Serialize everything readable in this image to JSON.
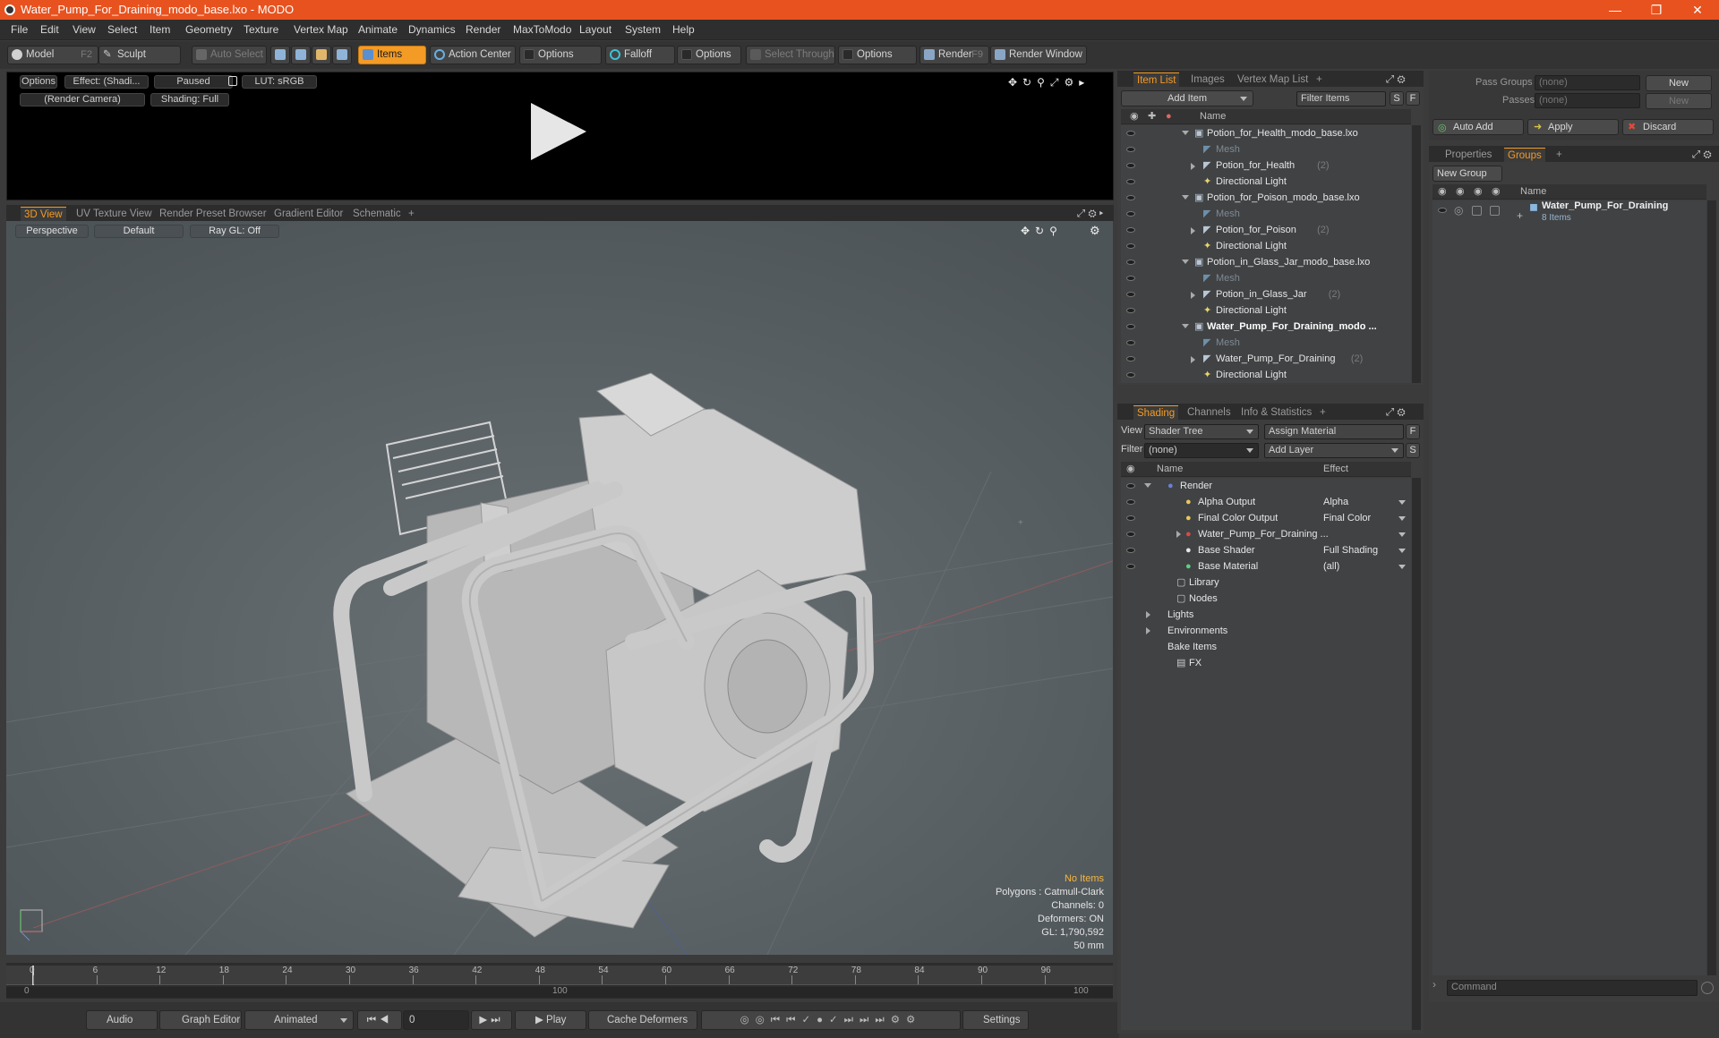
{
  "window": {
    "title": "Water_Pump_For_Draining_modo_base.lxo - MODO"
  },
  "menu": [
    "File",
    "Edit",
    "View",
    "Select",
    "Item",
    "Geometry",
    "Texture",
    "Vertex Map",
    "Animate",
    "Dynamics",
    "Render",
    "MaxToModo",
    "Layout",
    "System",
    "Help"
  ],
  "toolbar": {
    "model": "Model",
    "model_key": "F2",
    "sculpt": "Sculpt",
    "auto_select": "Auto Select",
    "items": "Items",
    "action_center": "Action Center",
    "options1": "Options",
    "falloff": "Falloff",
    "options2": "Options",
    "select_through": "Select Through",
    "options3": "Options",
    "render": "Render",
    "render_key": "F9",
    "render_window": "Render Window"
  },
  "preview": {
    "options": "Options",
    "effect": "Effect: (Shadi...",
    "paused": "Paused",
    "lut": "LUT: sRGB",
    "camera": "(Render Camera)",
    "shading": "Shading: Full"
  },
  "viewport_tabs": [
    "3D View",
    "UV Texture View",
    "Render Preset Browser",
    "Gradient Editor",
    "Schematic"
  ],
  "viewport": {
    "perspective": "Perspective",
    "default": "Default",
    "raygl": "Ray GL: Off",
    "stats": {
      "no_items": "No Items",
      "polygons": "Polygons : Catmull-Clark",
      "channels": "Channels: 0",
      "deformers": "Deformers: ON",
      "gl": "GL: 1,790,592",
      "focal": "50 mm"
    }
  },
  "timeline": {
    "ticks": [
      "0",
      "6",
      "12",
      "18",
      "24",
      "30",
      "36",
      "42",
      "48",
      "54",
      "60",
      "66",
      "72",
      "78",
      "84",
      "90",
      "96"
    ],
    "sub_ticks": [
      "0",
      "100",
      "100"
    ]
  },
  "bottom": {
    "audio": "Audio",
    "graph_editor": "Graph Editor",
    "animated": "Animated",
    "frame": "0",
    "play": "Play",
    "cache": "Cache Deformers",
    "settings": "Settings"
  },
  "item_list": {
    "tabs": [
      "Item List",
      "Images",
      "Vertex Map List"
    ],
    "add_item": "Add Item",
    "filter_items": "Filter Items",
    "s": "S",
    "f": "F",
    "col_name": "Name",
    "rows": [
      {
        "label": "Potion_for_Health_modo_base.lxo",
        "count": "",
        "type": "scene"
      },
      {
        "label": "Mesh",
        "count": "",
        "type": "mesh"
      },
      {
        "label": "Potion_for_Health",
        "count": "(2)",
        "type": "group"
      },
      {
        "label": "Directional Light",
        "count": "",
        "type": "light"
      },
      {
        "label": "Potion_for_Poison_modo_base.lxo",
        "count": "",
        "type": "scene"
      },
      {
        "label": "Mesh",
        "count": "",
        "type": "mesh"
      },
      {
        "label": "Potion_for_Poison",
        "count": "(2)",
        "type": "group"
      },
      {
        "label": "Directional Light",
        "count": "",
        "type": "light"
      },
      {
        "label": "Potion_in_Glass_Jar_modo_base.lxo",
        "count": "",
        "type": "scene"
      },
      {
        "label": "Mesh",
        "count": "",
        "type": "mesh"
      },
      {
        "label": "Potion_in_Glass_Jar",
        "count": "(2)",
        "type": "group"
      },
      {
        "label": "Directional Light",
        "count": "",
        "type": "light"
      },
      {
        "label": "Water_Pump_For_Draining_modo ...",
        "count": "",
        "type": "scene-bold"
      },
      {
        "label": "Mesh",
        "count": "",
        "type": "mesh"
      },
      {
        "label": "Water_Pump_For_Draining",
        "count": "(2)",
        "type": "group"
      },
      {
        "label": "Directional Light",
        "count": "",
        "type": "light"
      }
    ]
  },
  "shading": {
    "tabs": [
      "Shading",
      "Channels",
      "Info & Statistics"
    ],
    "view_label": "View",
    "view_value": "Shader Tree",
    "assign_material": "Assign Material",
    "filter_label": "Filter",
    "filter_value": "(none)",
    "add_layer": "Add Layer",
    "col_name": "Name",
    "col_effect": "Effect",
    "rows": [
      {
        "label": "Render",
        "effect": "",
        "indent": 0
      },
      {
        "label": "Alpha Output",
        "effect": "Alpha",
        "indent": 2
      },
      {
        "label": "Final Color Output",
        "effect": "Final Color",
        "indent": 2
      },
      {
        "label": "Water_Pump_For_Draining ...",
        "effect": "",
        "indent": 2
      },
      {
        "label": "Base Shader",
        "effect": "Full Shading",
        "indent": 2
      },
      {
        "label": "Base Material",
        "effect": "(all)",
        "indent": 2
      },
      {
        "label": "Library",
        "effect": "",
        "indent": 1
      },
      {
        "label": "Nodes",
        "effect": "",
        "indent": 1
      },
      {
        "label": "Lights",
        "effect": "",
        "indent": 0
      },
      {
        "label": "Environments",
        "effect": "",
        "indent": 0
      },
      {
        "label": "Bake Items",
        "effect": "",
        "indent": 0
      },
      {
        "label": "FX",
        "effect": "",
        "indent": 1
      }
    ]
  },
  "pass": {
    "pass_groups": "Pass Groups",
    "passes": "Passes",
    "none": "(none)",
    "new": "New",
    "auto_add": "Auto Add",
    "apply": "Apply",
    "discard": "Discard"
  },
  "groups": {
    "tabs": [
      "Properties",
      "Groups"
    ],
    "new_group": "New Group",
    "col_name": "Name",
    "item_name": "Water_Pump_For_Draining",
    "item_sub": "8 Items",
    "command": "Command"
  }
}
